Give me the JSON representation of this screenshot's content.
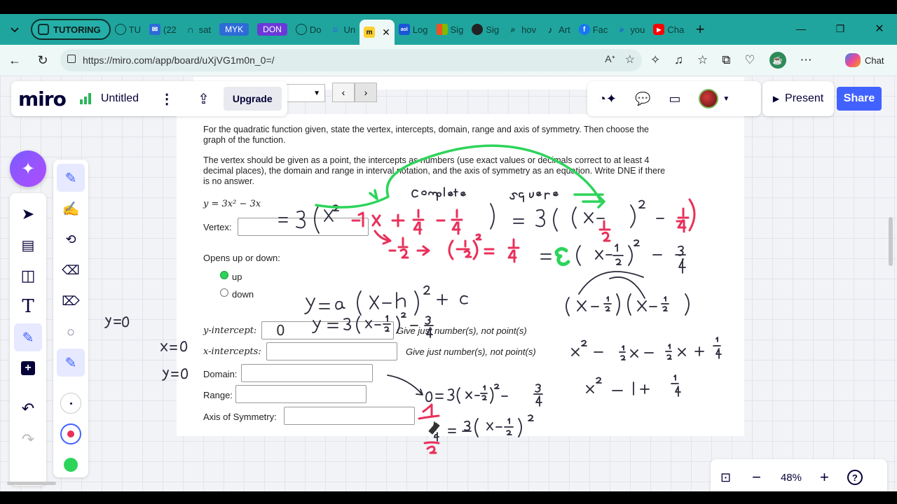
{
  "browser": {
    "group_label": "TUTORING",
    "tabs": [
      {
        "label": "TU",
        "icon": "globe-icon"
      },
      {
        "label": "(22",
        "icon": "mail-icon"
      },
      {
        "label": "sat",
        "icon": "headphones-icon"
      },
      {
        "label": "MYK",
        "icon": "myk-tab"
      },
      {
        "label": "DON",
        "icon": "don-tab"
      },
      {
        "label": "Do",
        "icon": "globe-icon"
      },
      {
        "label": "Un",
        "icon": "doc-icon"
      },
      {
        "label": "",
        "icon": "miro-icon"
      },
      {
        "label": "Log",
        "icon": "aol-icon"
      },
      {
        "label": "Sig",
        "icon": "microsoft-icon"
      },
      {
        "label": "Sig",
        "icon": "github-icon"
      },
      {
        "label": "hov",
        "icon": "search-icon"
      },
      {
        "label": "Art",
        "icon": "tiktok-icon"
      },
      {
        "label": "Fac",
        "icon": "facebook-icon"
      },
      {
        "label": "you",
        "icon": "search-icon"
      },
      {
        "label": "Cha",
        "icon": "youtube-icon"
      }
    ],
    "url": "https://miro.com/app/board/uXjVG1m0n_0=/",
    "chat_label": "Chat"
  },
  "miro": {
    "logo": "miro",
    "board_title": "Untitled",
    "upgrade_label": "Upgrade",
    "present_label": "Present",
    "share_label": "Share",
    "zoom": "48%"
  },
  "worksheet": {
    "intro": "For the quadratic function given, state the vertex, intercepts, domain, range and axis of symmetry. Then choose the graph of the function.",
    "instructions": "The vertex should be given as a point, the intercepts as numbers (use exact values or decimals correct to at least 4 decimal places), the domain and range in interval notation, and the axis of symmetry as an equation.  Write DNE if there is no answer.",
    "function": "y = 3x² − 3x",
    "vertex_label": "Vertex:",
    "opens_label": "Opens up or down:",
    "option_up": "up",
    "option_down": "down",
    "y_intercept_label": "y-intercept:",
    "y_intercept_value": "0",
    "y_intercept_hint": "Give just number(s), not point(s)",
    "x_intercepts_label": "x-intercepts:",
    "x_intercepts_hint": "Give just number(s), not point(s)",
    "domain_label": "Domain:",
    "range_label": "Range:",
    "axis_label": "Axis of Symmetry:"
  },
  "colors": {
    "tab_bar": "#1fa59e",
    "share_blue": "#4262ff",
    "ink_black": "#2a2a3a",
    "ink_pink": "#e8305a",
    "ink_green": "#2dd45a"
  }
}
